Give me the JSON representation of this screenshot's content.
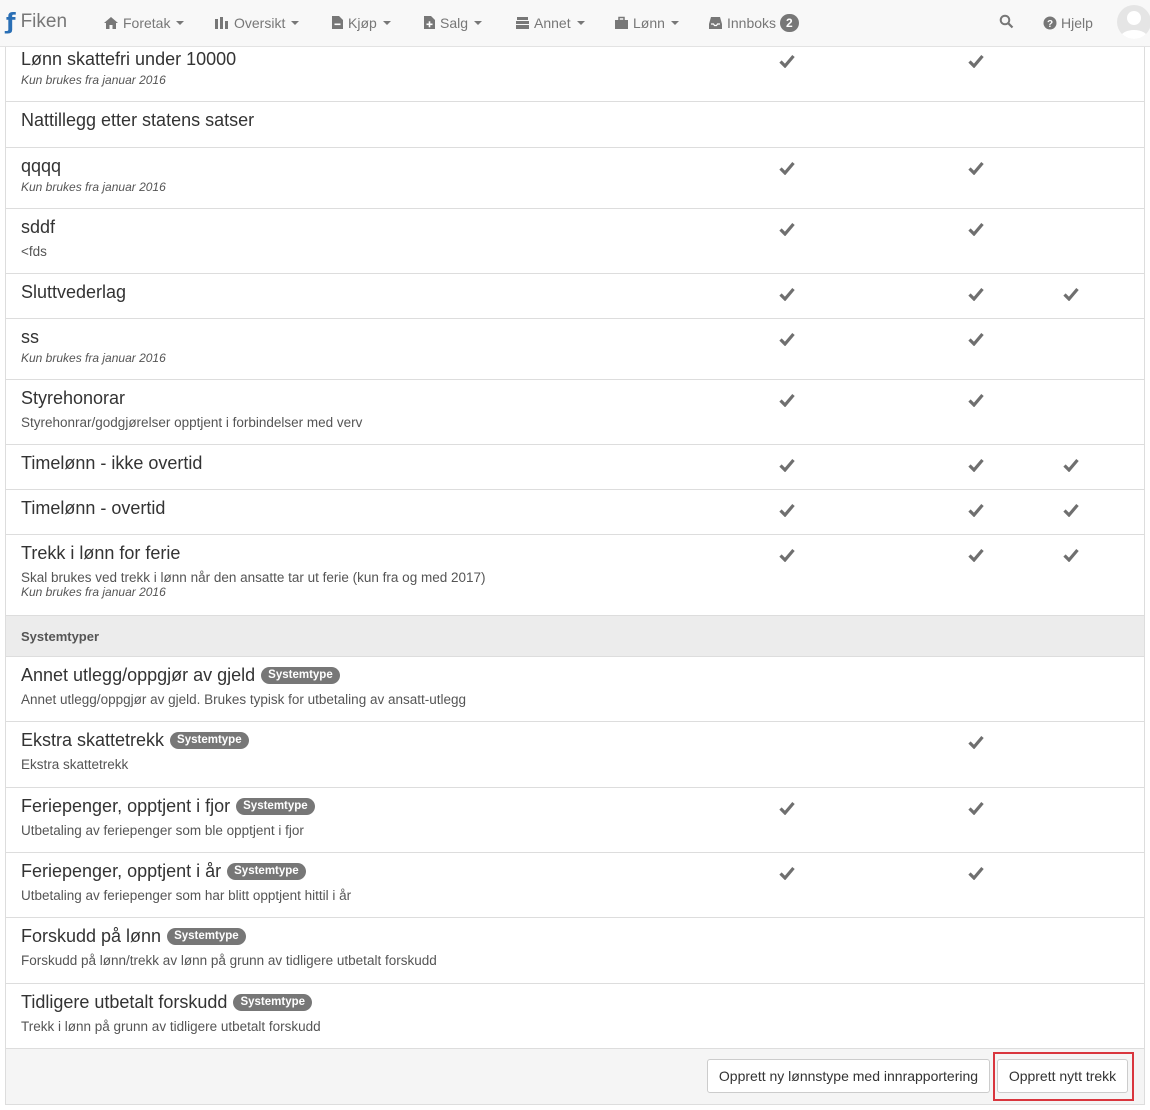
{
  "navbar": {
    "brand": "Fiken",
    "items": [
      {
        "label": "Foretak",
        "icon": "home-icon"
      },
      {
        "label": "Oversikt",
        "icon": "bar-chart-icon"
      },
      {
        "label": "Kjøp",
        "icon": "file-minus-icon"
      },
      {
        "label": "Salg",
        "icon": "file-plus-icon"
      },
      {
        "label": "Annet",
        "icon": "stack-icon"
      },
      {
        "label": "Lønn",
        "icon": "briefcase-icon"
      },
      {
        "label": "Innboks",
        "icon": "inbox-icon",
        "badge": "2"
      }
    ],
    "help_label": "Hjelp"
  },
  "rows": [
    {
      "title": "Lønn skattefri under 10000",
      "note": "Kun brukes fra januar 2016",
      "checks": [
        true,
        true,
        false
      ]
    },
    {
      "title": "Nattillegg etter statens satser",
      "checks": [
        false,
        false,
        false
      ]
    },
    {
      "title": "qqqq",
      "note": "Kun brukes fra januar 2016",
      "checks": [
        true,
        true,
        false
      ]
    },
    {
      "title": "sddf",
      "sub": "<fds",
      "checks": [
        true,
        true,
        false
      ]
    },
    {
      "title": "Sluttvederlag",
      "checks": [
        true,
        true,
        true
      ]
    },
    {
      "title": "ss",
      "note": "Kun brukes fra januar 2016",
      "checks": [
        true,
        true,
        false
      ]
    },
    {
      "title": "Styrehonorar",
      "sub": "Styrehonrar/godgjørelser opptjent i forbindelser med verv",
      "checks": [
        true,
        true,
        false
      ]
    },
    {
      "title": "Timelønn - ikke overtid",
      "checks": [
        true,
        true,
        true
      ]
    },
    {
      "title": "Timelønn - overtid",
      "checks": [
        true,
        true,
        true
      ]
    },
    {
      "title": "Trekk i lønn for ferie",
      "sub": "Skal brukes ved trekk i lønn når den ansatte tar ut ferie (kun fra og med 2017)",
      "note": "Kun brukes fra januar 2016",
      "checks": [
        true,
        true,
        true
      ]
    }
  ],
  "section_label": "Systemtyper",
  "tag_label": "Systemtype",
  "system_rows": [
    {
      "title": "Annet utlegg/oppgjør av gjeld",
      "sub": "Annet utlegg/oppgjør av gjeld. Brukes typisk for utbetaling av ansatt-utlegg",
      "checks": [
        false,
        false,
        false
      ]
    },
    {
      "title": "Ekstra skattetrekk",
      "sub": "Ekstra skattetrekk",
      "checks": [
        false,
        true,
        false
      ]
    },
    {
      "title": "Feriepenger, opptjent i fjor",
      "sub": "Utbetaling av feriepenger som ble opptjent i fjor",
      "checks": [
        true,
        true,
        false
      ]
    },
    {
      "title": "Feriepenger, opptjent i år",
      "sub": "Utbetaling av feriepenger som har blitt opptjent hittil i år",
      "checks": [
        true,
        true,
        false
      ]
    },
    {
      "title": "Forskudd på lønn",
      "sub": "Forskudd på lønn/trekk av lønn på grunn av tidligere utbetalt forskudd",
      "checks": [
        false,
        false,
        false
      ]
    },
    {
      "title": "Tidligere utbetalt forskudd",
      "sub": "Trekk i lønn på grunn av tidligere utbetalt forskudd",
      "checks": [
        false,
        false,
        false
      ]
    }
  ],
  "buttons": {
    "create_type": "Opprett ny lønnstype med innrapportering",
    "create_trekk": "Opprett nytt trekk"
  },
  "colors": {
    "highlight": "#d9363e",
    "brand": "#2a6fb5"
  }
}
